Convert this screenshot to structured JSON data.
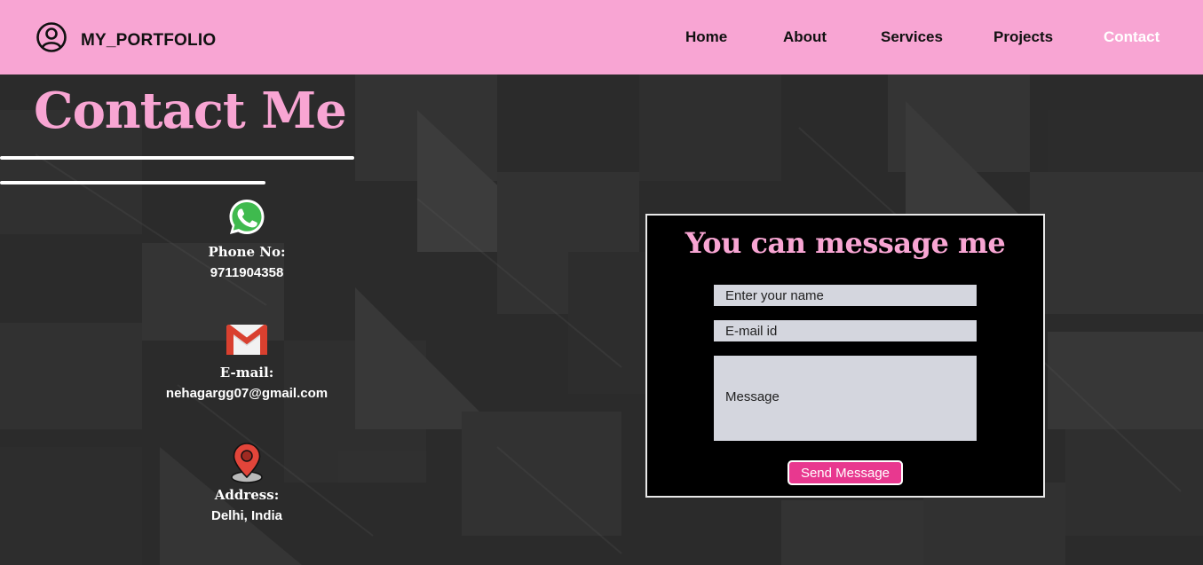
{
  "navbar": {
    "brand": "MY_PORTFOLIO",
    "brand_icon": "user-circle-icon",
    "background": "#f8a5d3",
    "links": [
      {
        "label": "Home",
        "active": false
      },
      {
        "label": "About",
        "active": false
      },
      {
        "label": "Services",
        "active": false
      },
      {
        "label": "Projects",
        "active": false
      },
      {
        "label": "Contact",
        "active": true
      }
    ]
  },
  "contact": {
    "title": "Contact Me",
    "accent_color": "#f8a5d3",
    "items": [
      {
        "icon": "whatsapp-icon",
        "label": "Phone No:",
        "value": "9711904358"
      },
      {
        "icon": "gmail-icon",
        "label": "E-mail:",
        "value": "nehagargg07@gmail.com"
      },
      {
        "icon": "location-pin-icon",
        "label": "Address:",
        "value": "Delhi, India"
      }
    ]
  },
  "form": {
    "title": "You can message me",
    "name_placeholder": "Enter your name",
    "email_placeholder": "E-mail id",
    "message_placeholder": "Message",
    "send_label": "Send Message",
    "button_color": "#e8388f"
  }
}
